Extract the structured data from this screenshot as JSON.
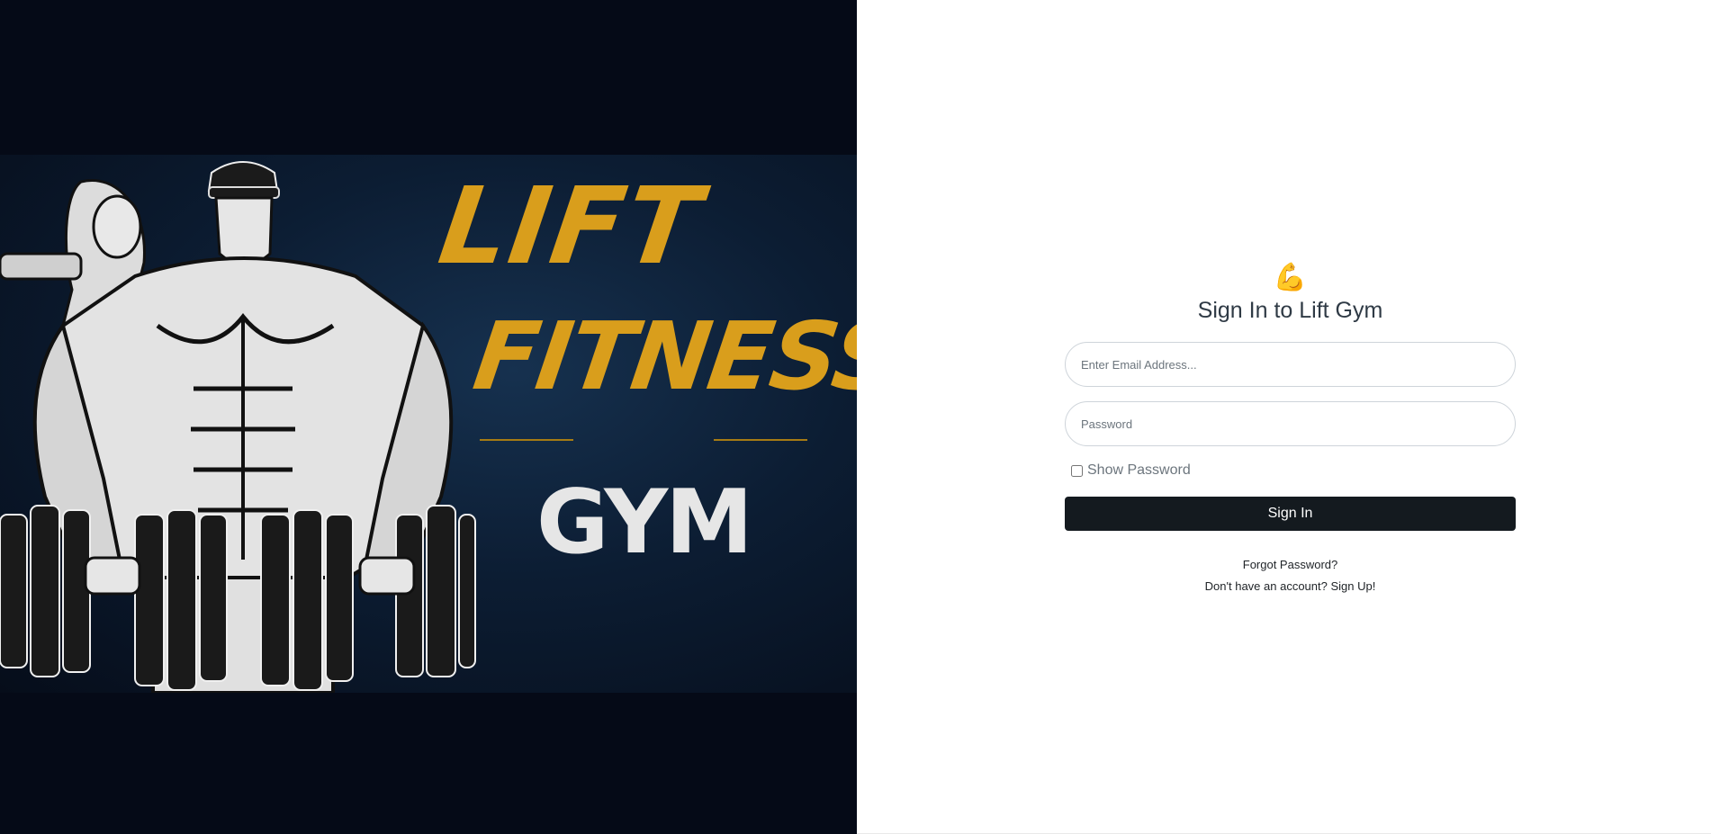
{
  "hero": {
    "brand_line1": "LIFT",
    "brand_line2": "FITNESS",
    "brand_line3": "GYM"
  },
  "login": {
    "icon": "flexed-biceps-icon",
    "icon_glyph": "💪",
    "title": "Sign In to Lift Gym",
    "email_placeholder": "Enter Email Address...",
    "password_placeholder": "Password",
    "show_password_label": "Show Password",
    "show_password_checked": false,
    "submit_label": "Sign In",
    "forgot_password_link": "Forgot Password?",
    "signup_link": "Don't have an account? Sign Up!"
  },
  "colors": {
    "hero_background": "#050a17",
    "brand_gold": "#d99e1c",
    "button_dark": "#141a1f"
  }
}
